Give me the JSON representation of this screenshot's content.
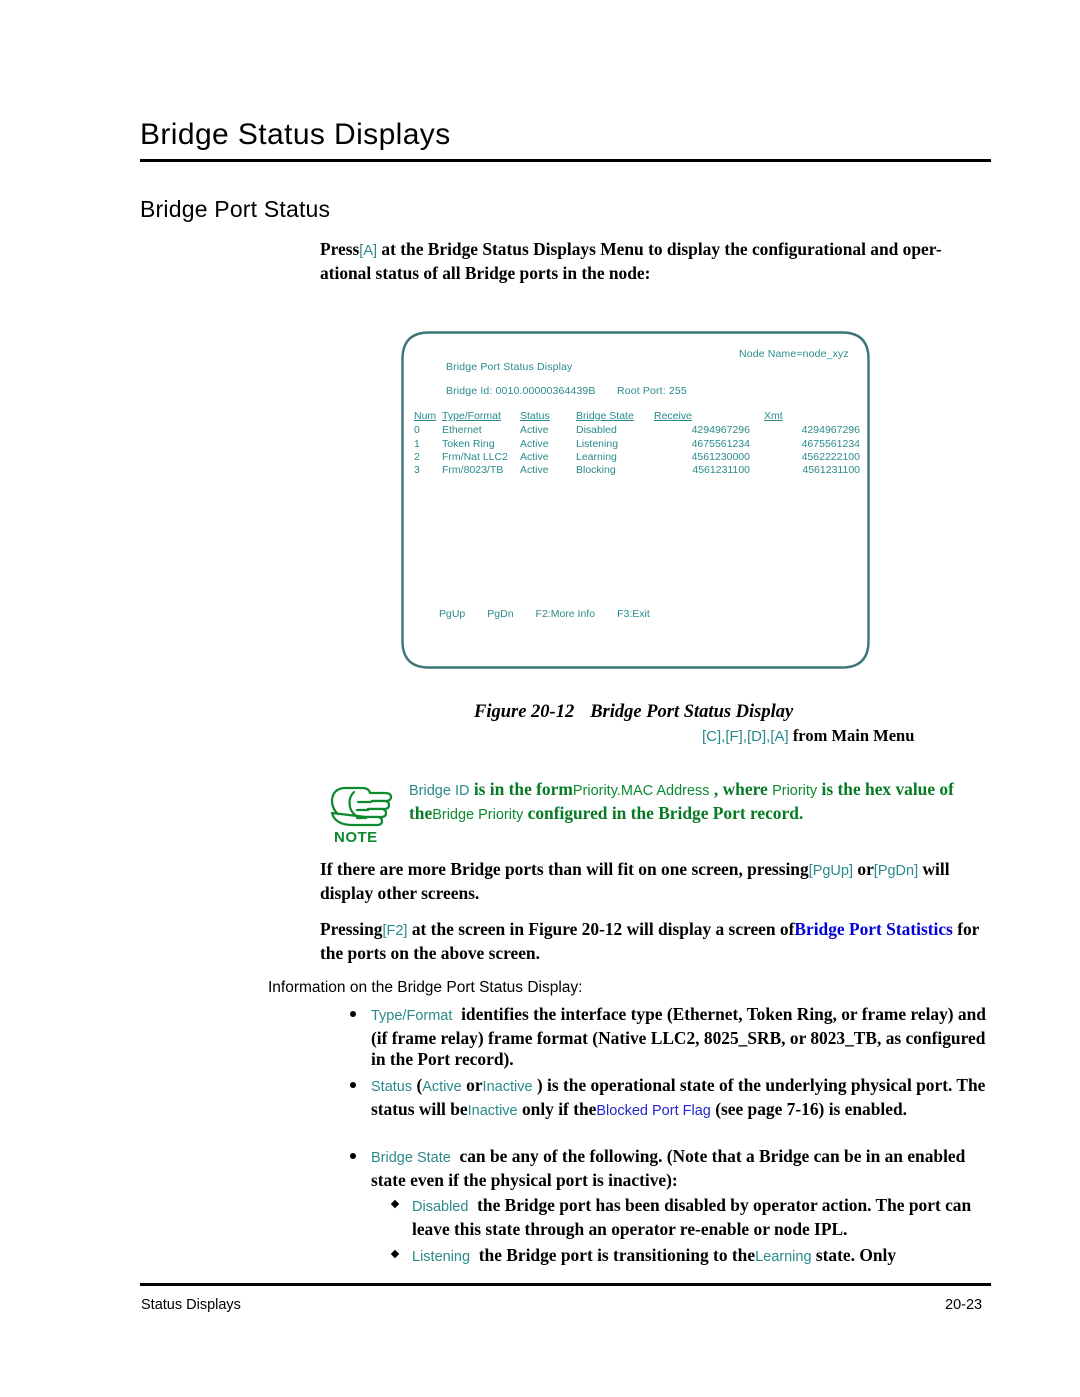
{
  "page": {
    "chapter_title": "Bridge Status Displays",
    "section_title": "Bridge Port Status",
    "footer_left": "Status Displays",
    "footer_right": "20-23"
  },
  "intro": {
    "before_key": "Press",
    "key": "[A]",
    "after_key": " at the Bridge Status Displays Menu to display the configurational and oper-ational status of all Bridge ports in the node:"
  },
  "terminal": {
    "node_name": "Node Name=node_xyz",
    "title": "Bridge Port Status Display",
    "bridge_id_label": "Bridge Id: 0010.00000364439B",
    "root_port_label": "Root Port: 255",
    "columns": [
      "Num",
      "Type/Format",
      "Status",
      "Bridge State",
      "Receive",
      "Xmt"
    ],
    "rows": [
      [
        "0",
        "Ethernet",
        "Active",
        "Disabled",
        "4294967296",
        "4294967296"
      ],
      [
        "1",
        "Token Ring",
        "Active",
        "Listening",
        "4675561234",
        "4675561234"
      ],
      [
        "2",
        "Frm/Nat LLC2",
        "Active",
        "Learning",
        "4561230000",
        "4562222100"
      ],
      [
        "3",
        "Frm/8023/TB",
        "Active",
        "Blocking",
        "4561231100",
        "4561231100"
      ]
    ],
    "footer_keys": [
      "PgUp",
      "PgDn",
      "F2:More Info",
      "F3:Exit"
    ]
  },
  "figure": {
    "number": "Figure 20-12",
    "caption": "Bridge Port Status Display",
    "menu_path_keys": "[C],[F],[D],[A]",
    "menu_path_suffix": "from Main Menu"
  },
  "note": {
    "icon_label": "NOTE",
    "term_bridge_id": "Bridge ID",
    "text_1": "is in the form",
    "term_priority_mac": "Priority.MAC Address",
    "text_2": ", where",
    "term_priority": "Priority",
    "text_3": "is the hex value of the",
    "term_bridge_priority": "Bridge Priority",
    "text_4": "configured in the Bridge Port record."
  },
  "para_pgup": {
    "text_1": "If there are more Bridge ports than will fit on one screen, pressing",
    "key_1": "[PgUp]",
    "text_2": "or",
    "key_2": "[PgDn]",
    "text_3": "will display other screens."
  },
  "para_f2": {
    "text_1": "Pressing",
    "key_1": "[F2]",
    "text_2": "at the screen in Figure 20-12 will display a screen of",
    "link": "Bridge Port Statistics",
    "text_3": "for the ports on the above screen."
  },
  "info_line": "Information on the Bridge Port Status Display:",
  "bullets": [
    {
      "term": "Type/Format",
      "text": "identifies the interface type (Ethernet, Token Ring, or frame relay) and (if frame relay) frame format (Native LLC2, 8025_SRB, or 8023_TB, as configured in the Port record)."
    },
    {
      "term": "Status",
      "paren_open": "(",
      "opt_1": "Active",
      "or": "or",
      "opt_2": "Inactive",
      "paren_close": ")",
      "text_1": "is the operational state of the underlying physical port. The status will be",
      "inline_term": "Inactive",
      "text_2": "only if the",
      "link": "Blocked Port Flag",
      "text_3": "(see page 7-16) is enabled."
    },
    {
      "term": "Bridge State",
      "text": "can be any of the following. (Note that a Bridge can be in an enabled state even if the physical port is inactive):"
    }
  ],
  "subbullets": [
    {
      "term": "Disabled",
      "text": "the Bridge port has been disabled by operator action. The port can leave this state through an operator re-enable or node IPL."
    },
    {
      "term": "Listening",
      "text_1": "the Bridge port is transitioning to the",
      "inline_term": "Learning",
      "text_2": "state. Only"
    }
  ],
  "colors": {
    "terminal_teal": "#2a8a8a",
    "note_green": "#067a24",
    "link_blue": "#0000d8"
  }
}
